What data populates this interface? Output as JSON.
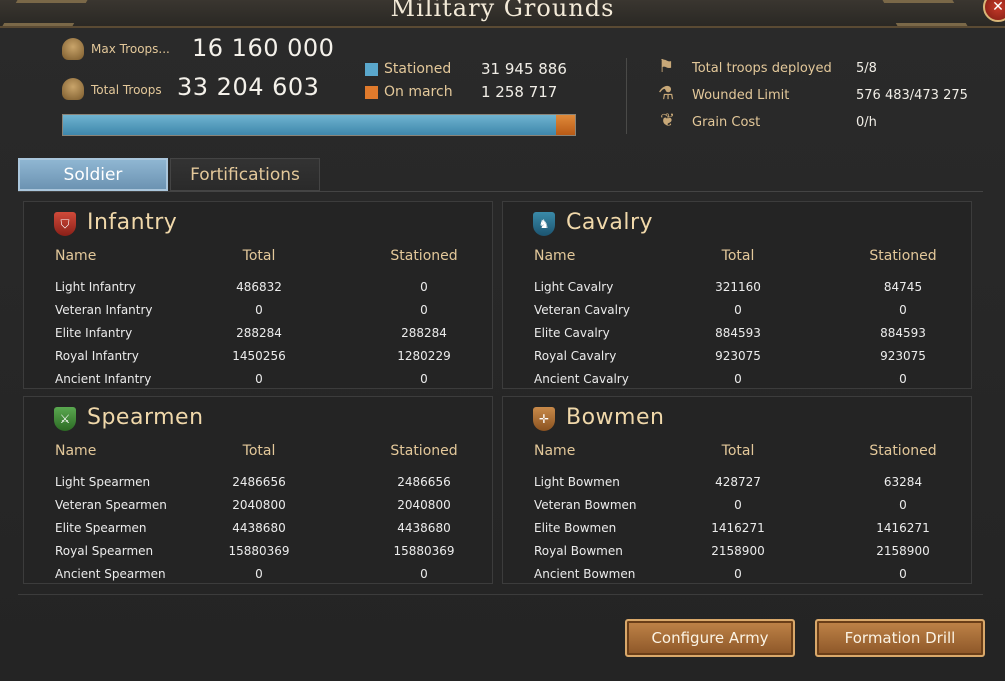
{
  "window": {
    "title": "Military Grounds",
    "close_icon": "close-icon"
  },
  "header": {
    "max_troops_label": "Max Troops...",
    "max_troops_value": "16 160 000",
    "total_troops_label": "Total Troops",
    "total_troops_value": "33 204 603",
    "stationed_label": "Stationed",
    "stationed_value": "31 945 886",
    "on_march_label": "On march",
    "on_march_value": "1 258 717",
    "stationed_fraction": 0.962,
    "colors": {
      "stationed": "#5aa7cc",
      "on_march": "#e07a2c"
    }
  },
  "right_stats": {
    "deployed_label": "Total troops deployed",
    "deployed_value": "5/8",
    "wounded_label": "Wounded Limit",
    "wounded_value": "576 483/473 275",
    "grain_label": "Grain Cost",
    "grain_value": "0/h"
  },
  "tabs": [
    {
      "label": "Soldier",
      "active": true
    },
    {
      "label": "Fortifications",
      "active": false
    }
  ],
  "columns": {
    "name": "Name",
    "total": "Total",
    "stationed": "Stationed"
  },
  "panels": {
    "infantry": {
      "title": "Infantry",
      "rows": [
        {
          "name": "Light Infantry",
          "total": "486832",
          "stationed": "0"
        },
        {
          "name": "Veteran Infantry",
          "total": "0",
          "stationed": "0"
        },
        {
          "name": "Elite Infantry",
          "total": "288284",
          "stationed": "288284"
        },
        {
          "name": "Royal Infantry",
          "total": "1450256",
          "stationed": "1280229"
        },
        {
          "name": "Ancient Infantry",
          "total": "0",
          "stationed": "0"
        }
      ]
    },
    "cavalry": {
      "title": "Cavalry",
      "rows": [
        {
          "name": "Light Cavalry",
          "total": "321160",
          "stationed": "84745"
        },
        {
          "name": "Veteran Cavalry",
          "total": "0",
          "stationed": "0"
        },
        {
          "name": "Elite Cavalry",
          "total": "884593",
          "stationed": "884593"
        },
        {
          "name": "Royal Cavalry",
          "total": "923075",
          "stationed": "923075"
        },
        {
          "name": "Ancient Cavalry",
          "total": "0",
          "stationed": "0"
        }
      ]
    },
    "spearmen": {
      "title": "Spearmen",
      "rows": [
        {
          "name": "Light Spearmen",
          "total": "2486656",
          "stationed": "2486656"
        },
        {
          "name": "Veteran Spearmen",
          "total": "2040800",
          "stationed": "2040800"
        },
        {
          "name": "Elite Spearmen",
          "total": "4438680",
          "stationed": "4438680"
        },
        {
          "name": "Royal Spearmen",
          "total": "15880369",
          "stationed": "15880369"
        },
        {
          "name": "Ancient Spearmen",
          "total": "0",
          "stationed": "0"
        }
      ]
    },
    "bowmen": {
      "title": "Bowmen",
      "rows": [
        {
          "name": "Light Bowmen",
          "total": "428727",
          "stationed": "63284"
        },
        {
          "name": "Veteran Bowmen",
          "total": "0",
          "stationed": "0"
        },
        {
          "name": "Elite Bowmen",
          "total": "1416271",
          "stationed": "1416271"
        },
        {
          "name": "Royal Bowmen",
          "total": "2158900",
          "stationed": "2158900"
        },
        {
          "name": "Ancient Bowmen",
          "total": "0",
          "stationed": "0"
        }
      ]
    }
  },
  "buttons": {
    "configure": "Configure Army",
    "drill": "Formation Drill"
  }
}
